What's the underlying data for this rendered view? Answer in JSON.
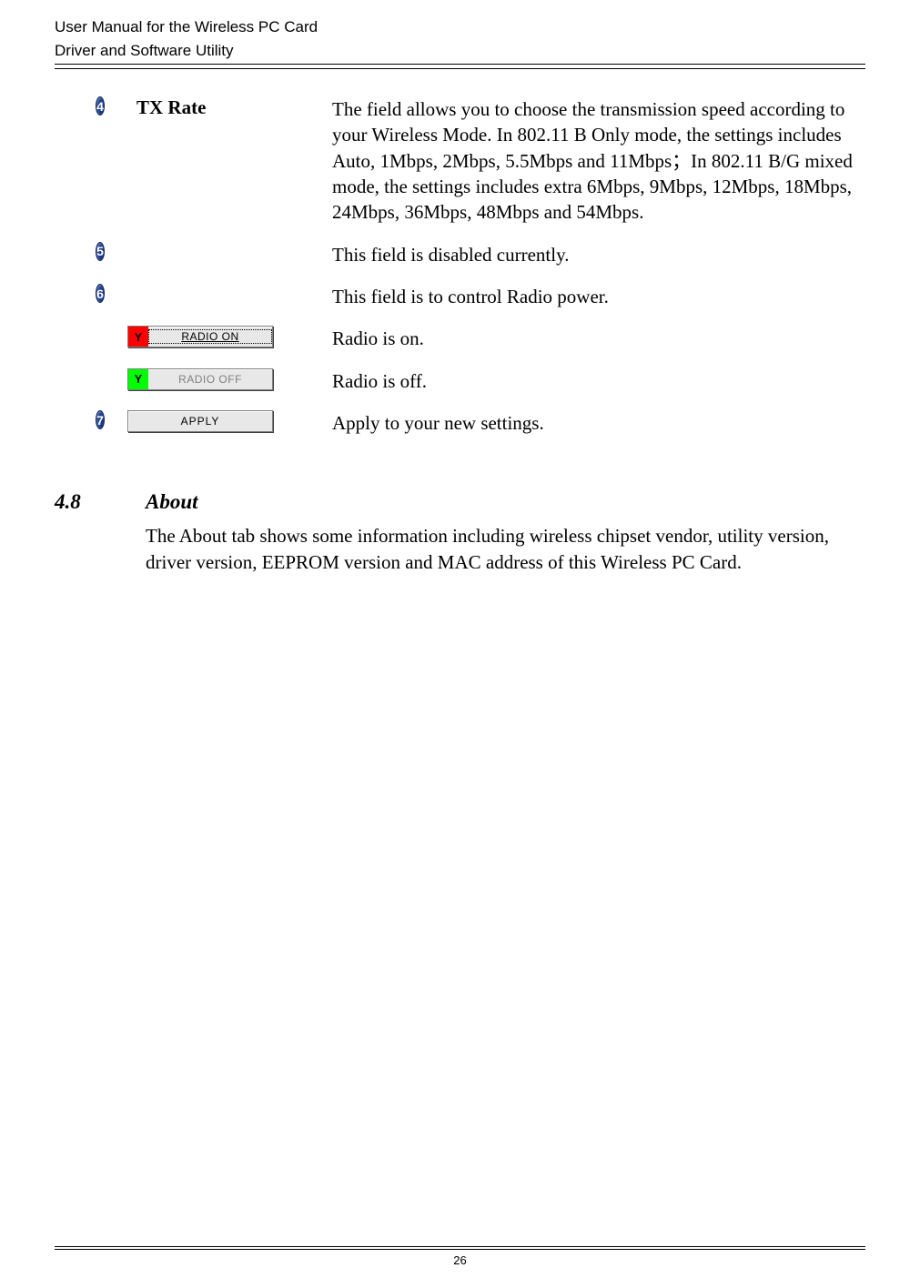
{
  "header": {
    "line1": "User Manual for the Wireless PC Card",
    "line2": "Driver and Software Utility"
  },
  "rows": [
    {
      "bullet": "4",
      "label": "TX Rate",
      "desc": "The field allows you to choose the transmission speed according to your Wireless Mode. In 802.11 B Only mode, the settings includes Auto, 1Mbps, 2Mbps, 5.5Mbps and 11Mbps；In 802.11 B/G mixed mode, the settings includes extra 6Mbps, 9Mbps, 12Mbps, 18Mbps, 24Mbps, 36Mbps, 48Mbps and 54Mbps."
    },
    {
      "bullet": "5",
      "desc": "This field is disabled currently."
    },
    {
      "bullet": "6",
      "desc": "This field is to control Radio power."
    },
    {
      "button_radio_on": "RADIO ON",
      "desc": "Radio is on."
    },
    {
      "button_radio_off": "RADIO OFF",
      "desc": "Radio is off."
    },
    {
      "bullet": "7",
      "button_apply": "APPLY",
      "desc": "Apply to your new settings."
    }
  ],
  "section": {
    "num": "4.8",
    "title": "About",
    "body": "The About tab shows some information including wireless chipset vendor, utility version, driver version, EEPROM version and MAC address of this Wireless PC Card."
  },
  "footer": {
    "page": "26"
  },
  "icons": {
    "antenna": "Y"
  }
}
